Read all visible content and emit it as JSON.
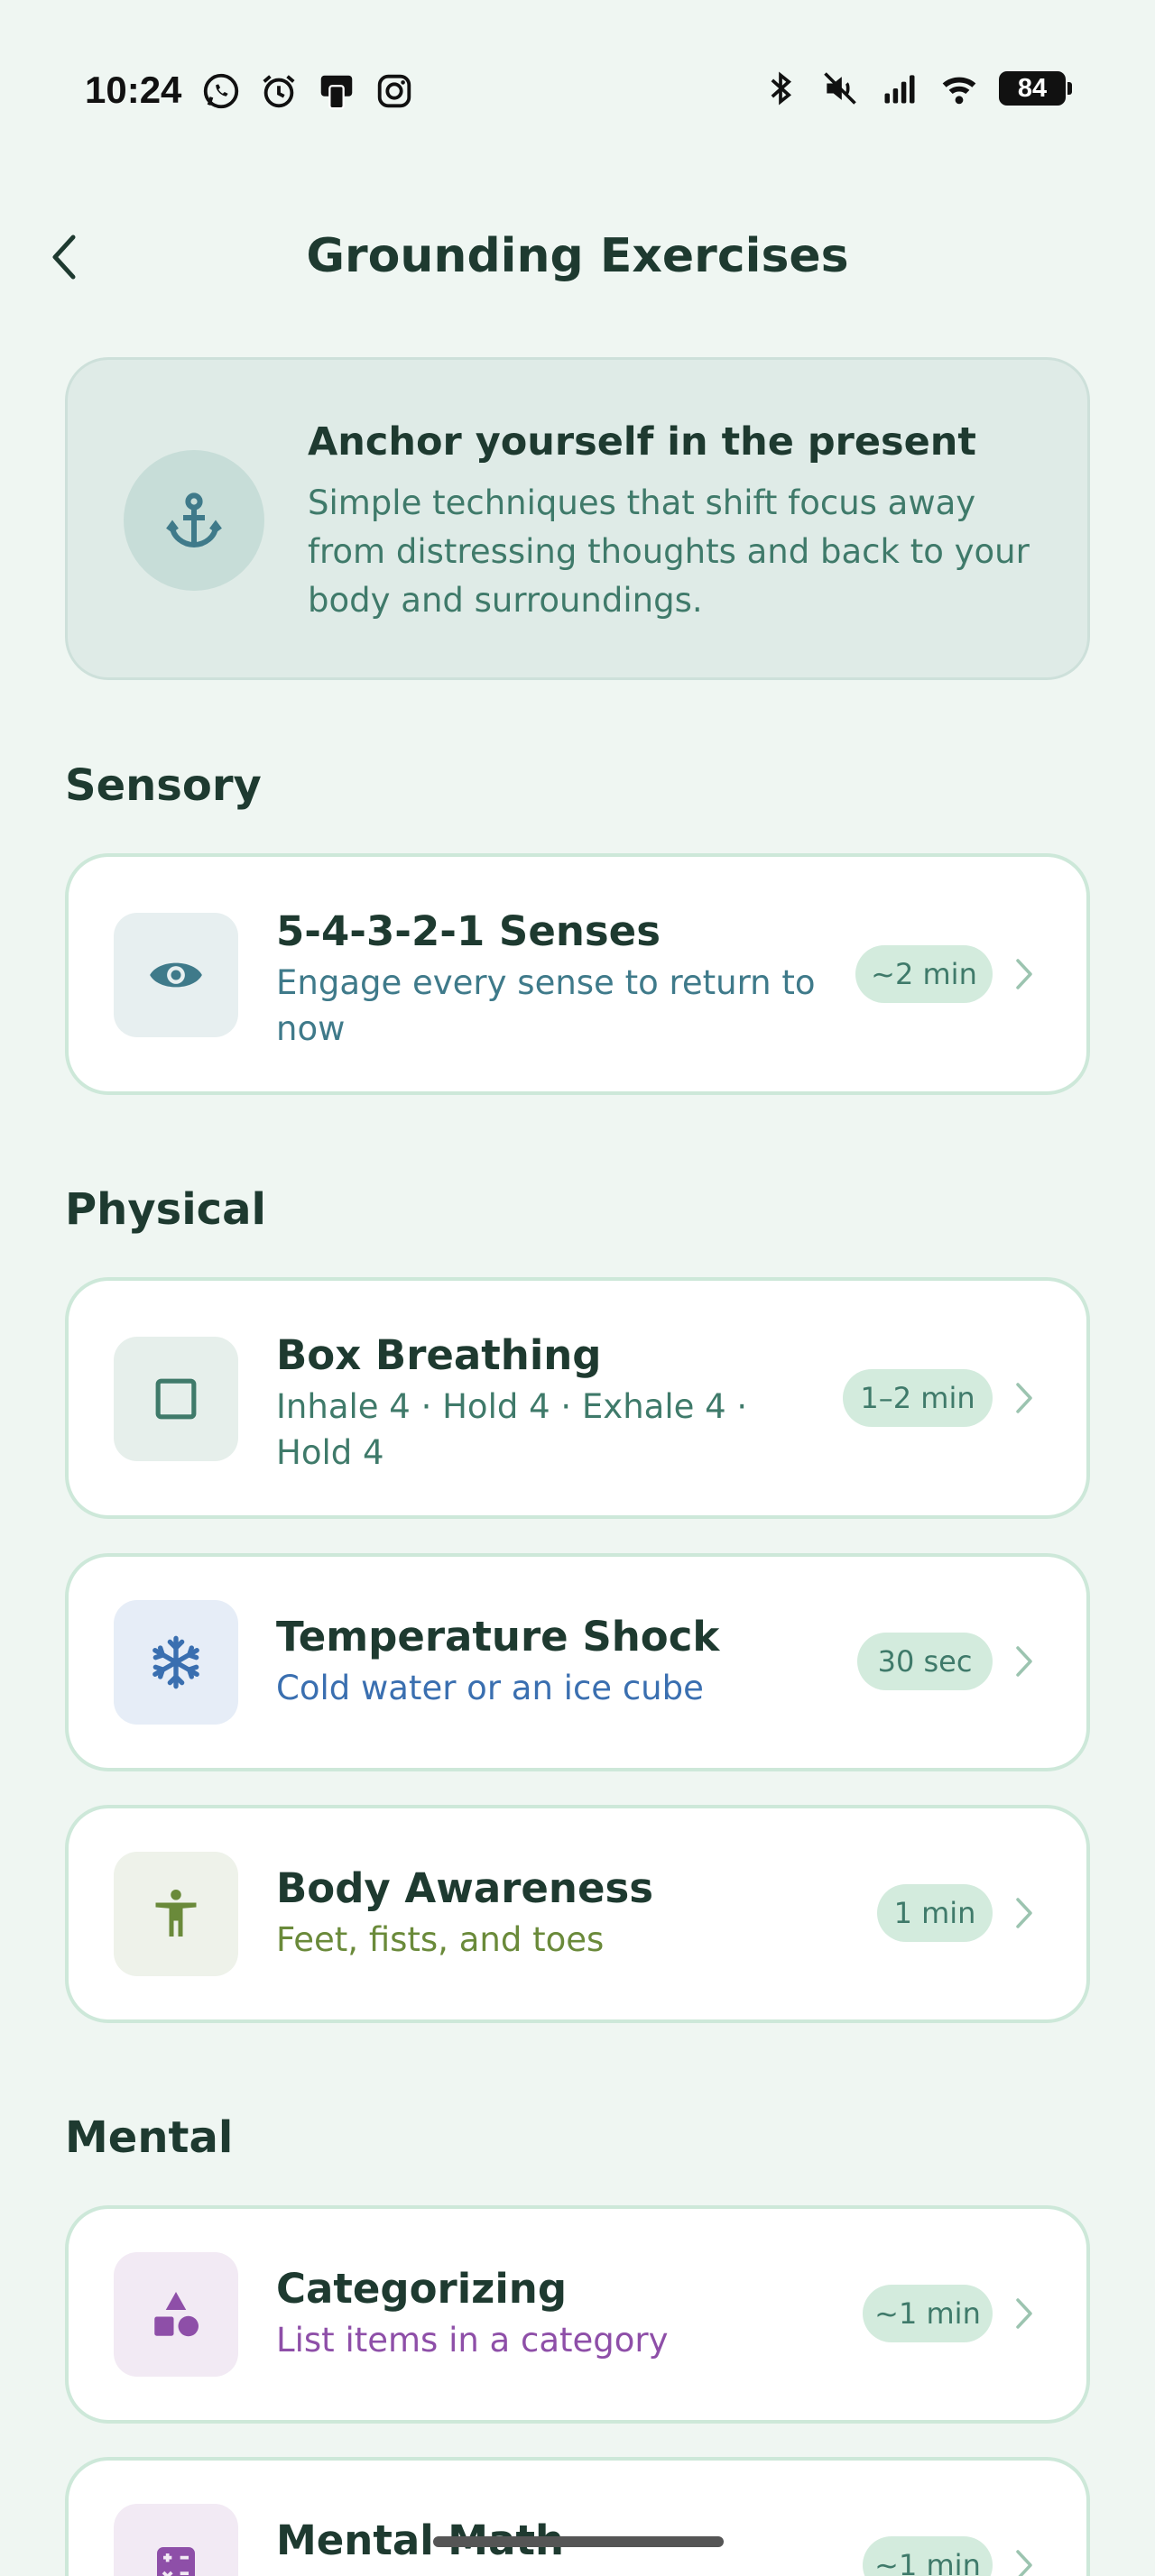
{
  "status_bar": {
    "time": "10:24",
    "battery": "84",
    "left_icons": [
      "whatsapp-icon",
      "alarm-icon",
      "device-icon",
      "instagram-icon"
    ],
    "right_icons": [
      "bluetooth-icon",
      "mute-icon",
      "signal-icon",
      "wifi-icon"
    ]
  },
  "header": {
    "title": "Grounding Exercises"
  },
  "intro": {
    "icon": "anchor-icon",
    "title": "Anchor yourself in the present",
    "text": "Simple techniques that shift focus away from distressing thoughts and back to your body and surroundings."
  },
  "sections": [
    {
      "heading": "Sensory",
      "items": [
        {
          "title": "5-4-3-2-1 Senses",
          "subtitle": "Engage every sense to return to now",
          "duration": "~2 min",
          "icon": "eye-icon",
          "accent": "#3F7A8A",
          "icon_bg": "#E7EFF0"
        }
      ]
    },
    {
      "heading": "Physical",
      "items": [
        {
          "title": "Box Breathing",
          "subtitle": "Inhale 4 · Hold 4 · Exhale 4 · Hold 4",
          "duration": "1–2 min",
          "icon": "square-icon",
          "accent": "#3F7A6A",
          "icon_bg": "#E6EFEB"
        },
        {
          "title": "Temperature Shock",
          "subtitle": "Cold water or an ice cube",
          "duration": "30 sec",
          "icon": "snowflake-icon",
          "accent": "#3A6FB0",
          "icon_bg": "#E6EDF7"
        },
        {
          "title": "Body Awareness",
          "subtitle": "Feet, fists, and toes",
          "duration": "1 min",
          "icon": "body-icon",
          "accent": "#6A8A3A",
          "icon_bg": "#EEF2EA"
        }
      ]
    },
    {
      "heading": "Mental",
      "items": [
        {
          "title": "Categorizing",
          "subtitle": "List items in a category",
          "duration": "~1 min",
          "icon": "shapes-icon",
          "accent": "#8E4FA8",
          "icon_bg": "#F2EAF4"
        },
        {
          "title": "Mental Math",
          "subtitle": "",
          "duration": "~1 min",
          "icon": "calculator-icon",
          "accent": "#8E4FA8",
          "icon_bg": "#F2EAF4"
        }
      ]
    }
  ]
}
